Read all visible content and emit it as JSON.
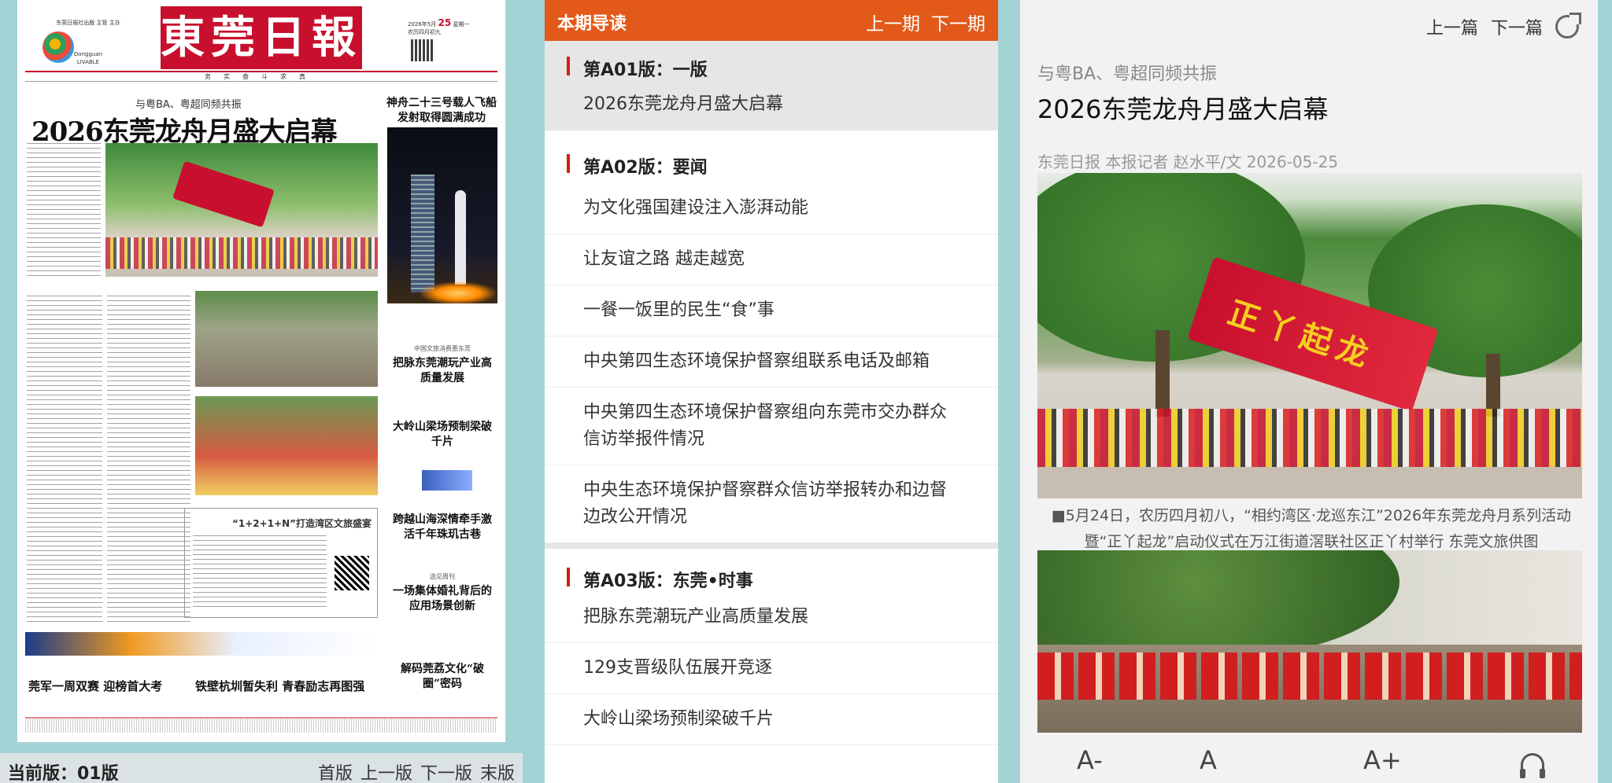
{
  "newspaper": {
    "masthead_name": "東莞日報",
    "info_left": [
      "东莞日报社出版 主管 主办",
      "Dongguan",
      "LIVABLE"
    ],
    "info_right": [
      "2026年5月",
      "25",
      "星期一",
      "农历四月初九"
    ],
    "motto": "务实奋斗求真",
    "sub_headline": "与粤BA、粤超同频共振",
    "headline": "2026东莞龙舟月盛大启幕",
    "side_headline": "神舟二十三号载人飞船发射取得圆满成功",
    "box_title": "“1+2+1+N”打造湾区文旅盛宴",
    "right_items": [
      {
        "kicker": "中国文旅消费惠东莞",
        "title": "把脉东莞潮玩产业高质量发展"
      },
      {
        "kicker": "",
        "title": "大岭山梁场预制梁破千片"
      },
      {
        "kicker": "",
        "title": "跨越山海深情牵手激活千年珠玑古巷"
      },
      {
        "kicker": "选见周刊",
        "title": "一场集体婚礼背后的应用场景创新"
      },
      {
        "kicker": "",
        "title": "解码莞荔文化“破圈”密码"
      }
    ],
    "bottom_heads": [
      "莞军一周双赛 迎榜首大考",
      "铁壁杭圳暂失利 青春励志再图强"
    ]
  },
  "page_bar": {
    "current_label": "当前版：01版",
    "nav": [
      "首版",
      "上一版",
      "下一版",
      "末版"
    ]
  },
  "toc": {
    "header_title": "本期导读",
    "prev_issue": "上一期",
    "next_issue": "下一期",
    "sections": [
      {
        "title": "第A01版：一版",
        "articles": [
          "2026东莞龙舟月盛大启幕"
        ]
      },
      {
        "title": "第A02版：要闻",
        "articles": [
          "为文化强国建设注入澎湃动能",
          "让友谊之路 越走越宽",
          "一餐一饭里的民生“食”事",
          "中央第四生态环境保护督察组联系电话及邮箱",
          "中央第四生态环境保护督察组向东莞市交办群众信访举报件情况",
          "中央生态环境保护督察群众信访举报转办和边督边改公开情况"
        ]
      },
      {
        "title": "第A03版：东莞•时事",
        "articles": [
          "把脉东莞潮玩产业高质量发展",
          "129支晋级队伍展开竞逐",
          "大岭山梁场预制梁破千片"
        ]
      }
    ]
  },
  "article": {
    "prev_label": "上一篇",
    "next_label": "下一篇",
    "pre_title": "与粤BA、粤超同频共振",
    "title": "2026东莞龙舟月盛大启幕",
    "meta": "东莞日报 本报记者 赵水平/文 2026-05-25",
    "photo_flag_text": "正丫起龙",
    "caption": "■5月24日，农历四月初八，“相约湾区·龙巡东江”2026年东莞龙舟月系列活动暨“正丫起龙”启动仪式在万江街道滘联社区正丫村举行 东莞文旅供图",
    "font_controls": [
      "A-",
      "A",
      "A+"
    ]
  }
}
